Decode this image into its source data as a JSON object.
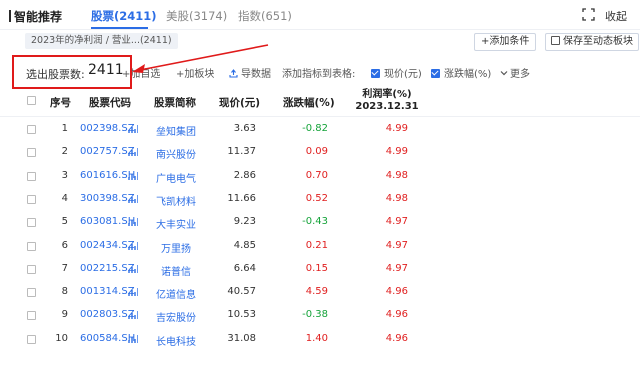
{
  "header": {
    "title": "智能推荐",
    "tabs": [
      {
        "label": "股票(2411)",
        "active": true
      },
      {
        "label": "美股(3174)",
        "active": false
      },
      {
        "label": "指数(651)",
        "active": false
      }
    ],
    "collapse_label": "收起"
  },
  "conditions": {
    "chip": "2023年的净利润 / 营业...(2411)",
    "add_condition": "+添加条件",
    "save_board": "保存至动态板块"
  },
  "toolbar": {
    "selected_label": "选出股票数:",
    "selected_count": "2411",
    "add_watch": "+加自选",
    "add_board": "+加板块",
    "export": "导数据",
    "add_metric": "添加指标到表格:",
    "metric_price": "现价(元)",
    "metric_change": "涨跌幅(%)",
    "more": "更多"
  },
  "table": {
    "headers": {
      "index": "序号",
      "code": "股票代码",
      "name": "股票简称",
      "price": "现价(元)",
      "change": "涨跌幅(%)",
      "pe_line1": "利润率(%)",
      "pe_line2": "2023.12.31"
    },
    "rows": [
      {
        "index": "1",
        "code": "002398.SZ",
        "name": "垒知集团",
        "price": "3.63",
        "change": "-0.82",
        "dir": "down",
        "rate": "4.99"
      },
      {
        "index": "2",
        "code": "002757.SZ",
        "name": "南兴股份",
        "price": "11.37",
        "change": "0.09",
        "dir": "up",
        "rate": "4.99"
      },
      {
        "index": "3",
        "code": "601616.SH",
        "name": "广电电气",
        "price": "2.86",
        "change": "0.70",
        "dir": "up",
        "rate": "4.98"
      },
      {
        "index": "4",
        "code": "300398.SZ",
        "name": "飞凯材料",
        "price": "11.66",
        "change": "0.52",
        "dir": "up",
        "rate": "4.98"
      },
      {
        "index": "5",
        "code": "603081.SH",
        "name": "大丰实业",
        "price": "9.23",
        "change": "-0.43",
        "dir": "down",
        "rate": "4.97"
      },
      {
        "index": "6",
        "code": "002434.SZ",
        "name": "万里扬",
        "price": "4.85",
        "change": "0.21",
        "dir": "up",
        "rate": "4.97"
      },
      {
        "index": "7",
        "code": "002215.SZ",
        "name": "诺普信",
        "price": "6.64",
        "change": "0.15",
        "dir": "up",
        "rate": "4.97"
      },
      {
        "index": "8",
        "code": "001314.SZ",
        "name": "亿道信息",
        "price": "40.57",
        "change": "4.59",
        "dir": "up",
        "rate": "4.96"
      },
      {
        "index": "9",
        "code": "002803.SZ",
        "name": "吉宏股份",
        "price": "10.53",
        "change": "-0.38",
        "dir": "down",
        "rate": "4.96"
      },
      {
        "index": "10",
        "code": "600584.SH",
        "name": "长电科技",
        "price": "31.08",
        "change": "1.40",
        "dir": "up",
        "rate": "4.96"
      }
    ]
  },
  "colors": {
    "accent": "#2b6de5",
    "up": "#e02020",
    "down": "#15a33a",
    "annotation": "#e01a1a"
  }
}
